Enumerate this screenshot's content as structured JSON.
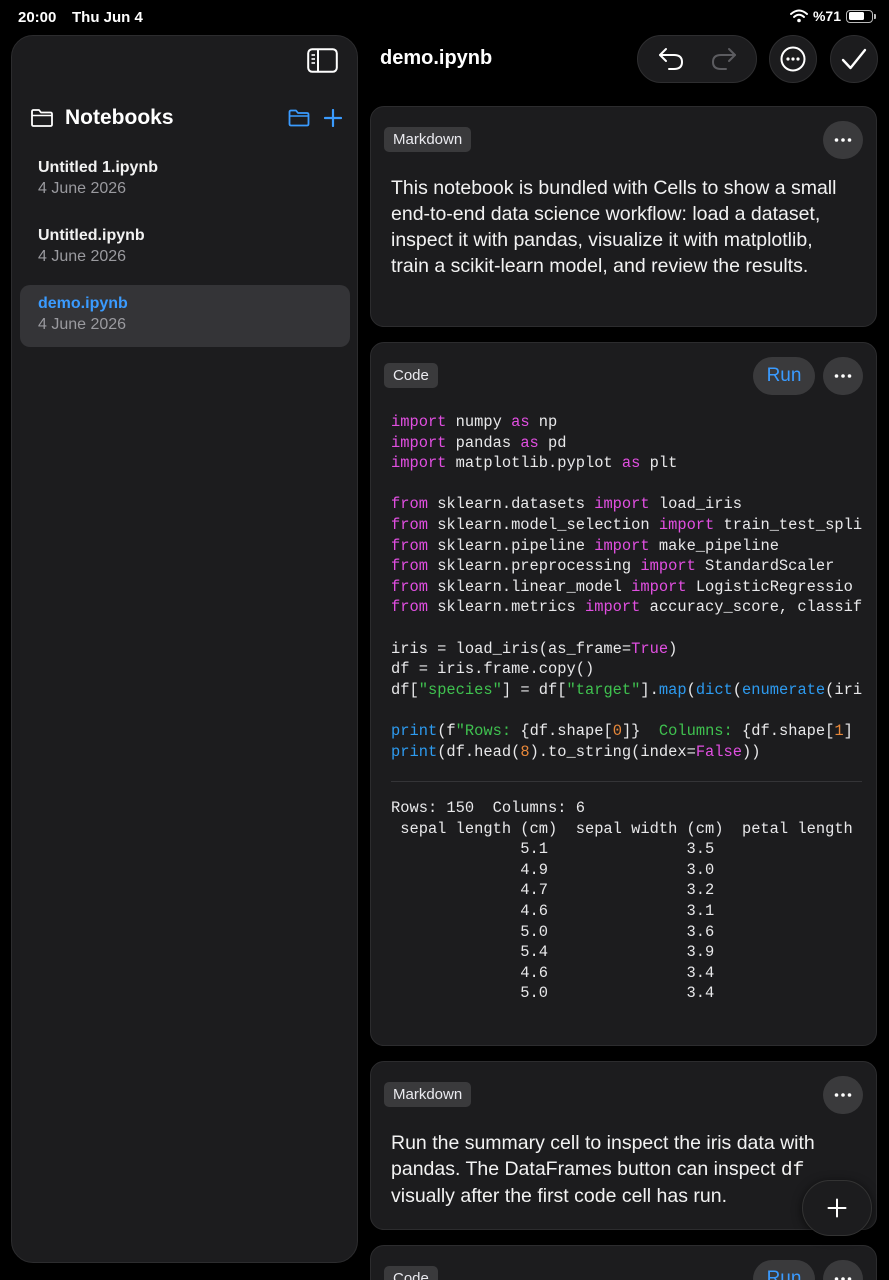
{
  "status": {
    "time": "20:00",
    "date": "Thu Jun 4",
    "battery": "%71",
    "battery_level": 0.71
  },
  "sidebar": {
    "title": "Notebooks",
    "items": [
      {
        "name": "Untitled 1.ipynb",
        "date": "4 June 2026",
        "selected": false
      },
      {
        "name": "Untitled.ipynb",
        "date": "4 June 2026",
        "selected": false
      },
      {
        "name": "demo.ipynb",
        "date": "4 June 2026",
        "selected": true
      }
    ]
  },
  "header": {
    "title": "demo.ipynb"
  },
  "cells": [
    {
      "type_label": "Markdown",
      "text": "This notebook is bundled with Cells to show a small end-to-end data science workflow: load a dataset, inspect it with pandas, visualize it with matplotlib, train a scikit-learn model, and review the results."
    },
    {
      "type_label": "Code",
      "run_label": "Run",
      "code_lines": [
        [
          [
            "kw",
            "import"
          ],
          [
            "t",
            " numpy "
          ],
          [
            "kw",
            "as"
          ],
          [
            "t",
            " np"
          ]
        ],
        [
          [
            "kw",
            "import"
          ],
          [
            "t",
            " pandas "
          ],
          [
            "kw",
            "as"
          ],
          [
            "t",
            " pd"
          ]
        ],
        [
          [
            "kw",
            "import"
          ],
          [
            "t",
            " matplotlib.pyplot "
          ],
          [
            "kw",
            "as"
          ],
          [
            "t",
            " plt"
          ]
        ],
        [],
        [
          [
            "kw",
            "from"
          ],
          [
            "t",
            " sklearn.datasets "
          ],
          [
            "kw",
            "import"
          ],
          [
            "t",
            " load_iris"
          ]
        ],
        [
          [
            "kw",
            "from"
          ],
          [
            "t",
            " sklearn.model_selection "
          ],
          [
            "kw",
            "import"
          ],
          [
            "t",
            " train_test_spli"
          ]
        ],
        [
          [
            "kw",
            "from"
          ],
          [
            "t",
            " sklearn.pipeline "
          ],
          [
            "kw",
            "import"
          ],
          [
            "t",
            " make_pipeline"
          ]
        ],
        [
          [
            "kw",
            "from"
          ],
          [
            "t",
            " sklearn.preprocessing "
          ],
          [
            "kw",
            "import"
          ],
          [
            "t",
            " StandardScaler"
          ]
        ],
        [
          [
            "kw",
            "from"
          ],
          [
            "t",
            " sklearn.linear_model "
          ],
          [
            "kw",
            "import"
          ],
          [
            "t",
            " LogisticRegressio"
          ]
        ],
        [
          [
            "kw",
            "from"
          ],
          [
            "t",
            " sklearn.metrics "
          ],
          [
            "kw",
            "import"
          ],
          [
            "t",
            " accuracy_score, classif"
          ]
        ],
        [],
        [
          [
            "t",
            "iris = load_iris(as_frame="
          ],
          [
            "kw",
            "True"
          ],
          [
            "t",
            ")"
          ]
        ],
        [
          [
            "t",
            "df = iris.frame.copy()"
          ]
        ],
        [
          [
            "t",
            "df["
          ],
          [
            "str",
            "\"species\""
          ],
          [
            "t",
            "] = df["
          ],
          [
            "str",
            "\"target\""
          ],
          [
            "t",
            "]."
          ],
          [
            "bi",
            "map"
          ],
          [
            "t",
            "("
          ],
          [
            "bi",
            "dict"
          ],
          [
            "t",
            "("
          ],
          [
            "bi",
            "enumerate"
          ],
          [
            "t",
            "(iri"
          ]
        ],
        [],
        [
          [
            "bi",
            "print"
          ],
          [
            "t",
            "(f"
          ],
          [
            "str",
            "\"Rows: "
          ],
          [
            "t",
            "{df.shape["
          ],
          [
            "num",
            "0"
          ],
          [
            "t",
            "]}"
          ],
          [
            "str",
            "  Columns: "
          ],
          [
            "t",
            "{df.shape["
          ],
          [
            "num",
            "1"
          ],
          [
            "t",
            "]"
          ]
        ],
        [
          [
            "bi",
            "print"
          ],
          [
            "t",
            "(df.head("
          ],
          [
            "num",
            "8"
          ],
          [
            "t",
            ").to_string(index="
          ],
          [
            "kw",
            "False"
          ],
          [
            "t",
            "))"
          ]
        ]
      ],
      "output_lines": [
        "Rows: 150  Columns: 6",
        " sepal length (cm)  sepal width (cm)  petal length",
        "              5.1               3.5",
        "              4.9               3.0",
        "              4.7               3.2",
        "              4.6               3.1",
        "              5.0               3.6",
        "              5.4               3.9",
        "              4.6               3.4",
        "              5.0               3.4"
      ]
    },
    {
      "type_label": "Markdown",
      "text_before": "Run the summary cell to inspect the iris data with pandas. The DataFrames button can inspect ",
      "inline_code": "df",
      "text_after": " visually after the first code cell has run."
    },
    {
      "type_label": "Code",
      "run_label": "Run"
    }
  ],
  "icons": {
    "sidebar_toggle": "sidebar-toggle-icon",
    "folder": "folder-icon",
    "new_folder": "folder-icon",
    "add": "plus-icon",
    "undo": "undo-icon",
    "redo": "redo-icon",
    "more": "ellipsis-icon",
    "done": "checkmark-icon"
  },
  "colors": {
    "accent": "#3a9bff",
    "keyword": "#e14fe1",
    "builtin": "#2d9bf0",
    "string": "#3fc14f",
    "number": "#e8883a"
  }
}
